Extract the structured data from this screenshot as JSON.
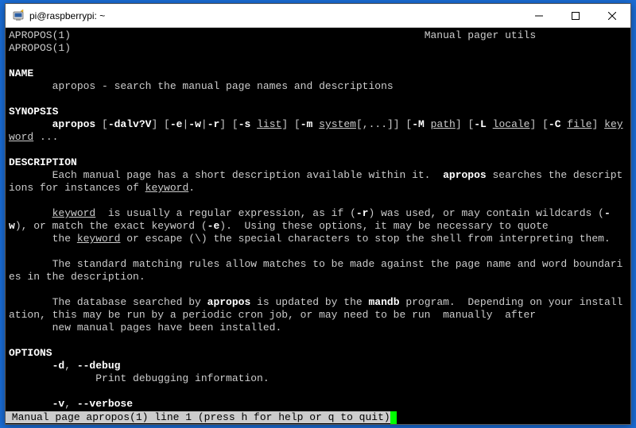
{
  "window": {
    "title": "pi@raspberrypi: ~"
  },
  "man": {
    "header_left": "APROPOS(1)",
    "header_center": "Manual pager utils",
    "header_right": "APROPOS(1)",
    "sec_name": "NAME",
    "name_line": "apropos - search the manual page names and descriptions",
    "sec_synopsis": "SYNOPSIS",
    "syn_cmd": "apropos",
    "syn_opts1": " [",
    "syn_opts1b": "-dalv?V",
    "syn_opts1c": "] [",
    "syn_opts2": "-e",
    "syn_opts2b": "|",
    "syn_opts3": "-w",
    "syn_opts3b": "|",
    "syn_opts4": "-r",
    "syn_opts4b": "] [",
    "syn_opts5": "-s",
    "syn_list": "list",
    "syn_opts6": "] [",
    "syn_opts7": "-m",
    "syn_system": "system",
    "syn_opts8": "[,...]] [",
    "syn_opts9": "-M",
    "syn_path": "path",
    "syn_opts10": "] [",
    "syn_opts11": "-L",
    "syn_locale": "locale",
    "syn_opts12": "] [",
    "syn_opts13": "-C",
    "syn_file": "file",
    "syn_opts14": "] ",
    "syn_keyword": "keyword",
    "syn_end": " ...",
    "sec_desc": "DESCRIPTION",
    "desc1a": "Each manual page has a short description available within it.  ",
    "desc1b": "apropos",
    "desc1c": " searches the descriptions for instances of ",
    "desc1d": "keyword",
    "desc1e": ".",
    "desc2a": "keyword",
    "desc2b": "  is usually a regular expression, as if (",
    "desc2c": "-r",
    "desc2d": ") was used, or may contain wildcards (",
    "desc2e": "-w",
    "desc2f": "), or match the exact keyword (",
    "desc2g": "-e",
    "desc2h": ").  Using these options, it may be necessary to quote",
    "desc3a": "the ",
    "desc3b": "keyword",
    "desc3c": " or escape (\\) the special characters to stop the shell from interpreting them.",
    "desc4": "The standard matching rules allow matches to be made against the page name and word boundaries in the description.",
    "desc5a": "The database searched by ",
    "desc5b": "apropos",
    "desc5c": " is updated by the ",
    "desc5d": "mandb",
    "desc5e": " program.  Depending on your installation, this may be run by a periodic cron job, or may need to be run  manually  after",
    "desc6": "new manual pages have been installed.",
    "sec_options": "OPTIONS",
    "opt1a": "-d",
    "opt1b": ", ",
    "opt1c": "--debug",
    "opt1desc": "Print debugging information.",
    "opt2a": "-v",
    "opt2b": ", ",
    "opt2c": "--verbose"
  },
  "status": " Manual page apropos(1) line 1 (press h for help or q to quit)"
}
